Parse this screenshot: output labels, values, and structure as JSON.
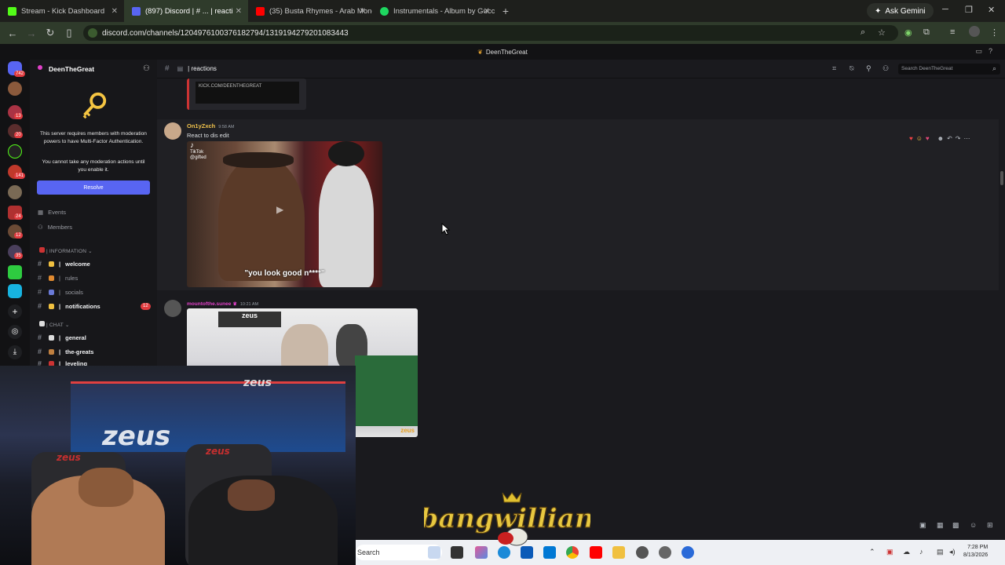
{
  "browser": {
    "tabs": [
      {
        "title": "Stream - Kick Dashboard",
        "color": "#53fc18"
      },
      {
        "title": "(897) Discord | # ... | reacti",
        "color": "#5865f2"
      },
      {
        "title": "(35) Busta Rhymes - Arab Mone",
        "color": "#ff0000"
      },
      {
        "title": "Instrumentals - Album by Gucc",
        "color": "#1ed760"
      }
    ],
    "new_tab": "+",
    "ask_gemini": "Ask Gemini",
    "url": "discord.com/channels/1204976100376182794/1319194279201083443"
  },
  "discord": {
    "window_title": "DeenTheGreat",
    "server_name": "DeenTheGreat",
    "server_badges": [
      "742",
      "13",
      "20",
      "141",
      "24",
      "12",
      "35"
    ],
    "mfa_notice": "This server requires members with moderation powers to have Multi-Factor Authentication.",
    "mfa_warning": "You cannot take any moderation actions until you enable it.",
    "resolve_label": "Resolve",
    "nav": {
      "events": "Events",
      "members": "Members"
    },
    "categories": {
      "information": "INFORMATION",
      "chat": "CHAT"
    },
    "channels": {
      "welcome": "welcome",
      "rules": "rules",
      "socials": "socials",
      "notifications": "notifications",
      "notifications_badge": "12",
      "general": "general",
      "the_greats": "the-greats",
      "leveling": "leveling"
    },
    "channel_header": "reactions",
    "search_placeholder": "Search DeenTheGreat",
    "embed_kick_text": "KICK.COM/DEENTHEGREAT",
    "messages": [
      {
        "author": "On1yZxch",
        "time": "9:58 AM",
        "text": "React to dis edit",
        "video_caption": "\"you look good n****\"",
        "tiktok_label": "TikTok",
        "tiktok_user": "@gifted",
        "author_color": "#f0c24b"
      },
      {
        "author": "mountofthe.sunee",
        "time": "10:21 AM",
        "author_color": "#e040c8",
        "zeus_label": "zeus"
      }
    ]
  },
  "overlay": {
    "brand": "Kbangwilliams",
    "ring_banner": "zeus",
    "chair_text": "zeus"
  },
  "taskbar": {
    "search": "Search",
    "time": "7:28 PM",
    "date": "8/13/2026"
  }
}
